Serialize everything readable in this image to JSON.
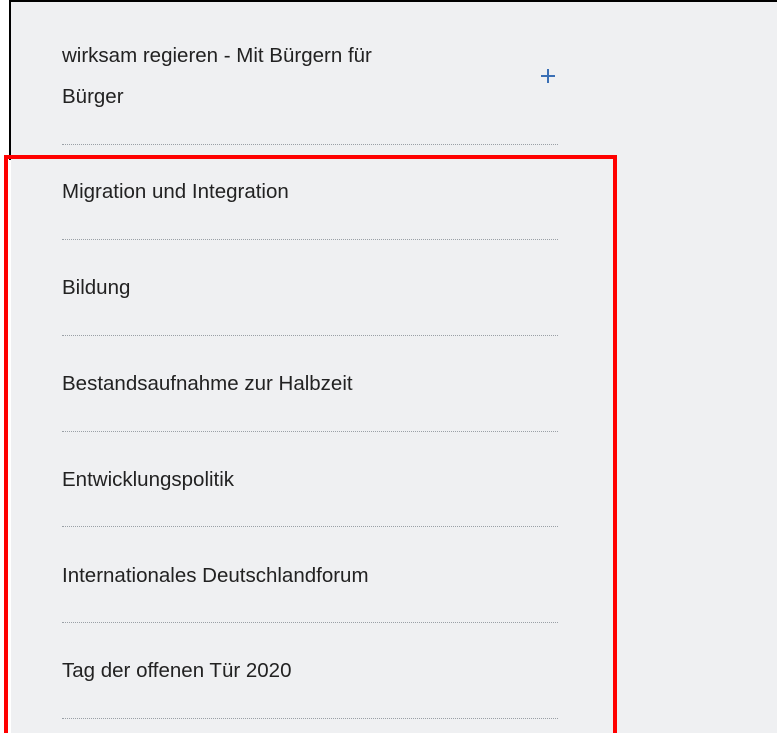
{
  "menu": {
    "expandable_item": {
      "label_line1": "wirksam regieren - Mit Bürgern für",
      "label_line2": "Bürger",
      "expand_icon": "plus-icon"
    },
    "items": [
      {
        "label": "Migration und Integration"
      },
      {
        "label": "Bildung"
      },
      {
        "label": "Bestandsaufnahme zur Halbzeit"
      },
      {
        "label": "Entwicklungspolitik"
      },
      {
        "label": "Internationales Deutschlandforum"
      },
      {
        "label": "Tag der offenen Tür 2020"
      }
    ]
  },
  "colors": {
    "panel_background": "#eff0f2",
    "text": "#222222",
    "accent": "#3a6fb5",
    "highlight": "#ff0000"
  }
}
